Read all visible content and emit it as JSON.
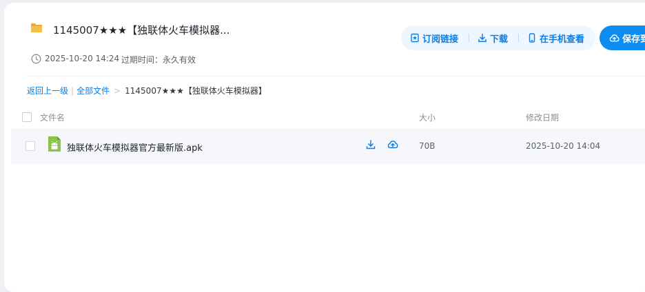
{
  "share": {
    "title": "1145007★★★【独联体火车模拟器...",
    "date": "2025-10-20 14:24",
    "expire_label": "过期时间：",
    "expire_value": "永久有效"
  },
  "actions": {
    "subscribe": "订阅链接",
    "download": "下载",
    "mobile": "在手机查看",
    "save": "保存到"
  },
  "breadcrumb": {
    "back": "返回上一级",
    "separator": "|",
    "all_files": "全部文件",
    "arrow": ">",
    "current": "1145007★★★【独联体火车模拟器】"
  },
  "table": {
    "columns": {
      "name": "文件名",
      "size": "大小",
      "modified": "修改日期"
    },
    "rows": [
      {
        "name": "独联体火车模拟器官方最新版.apk",
        "size": "70B",
        "modified": "2025-10-20 14:04"
      }
    ]
  },
  "colors": {
    "accent": "#0d8cf2",
    "link": "#0b7ee6",
    "folder": "#f5c04a",
    "android": "#8bc34a"
  }
}
